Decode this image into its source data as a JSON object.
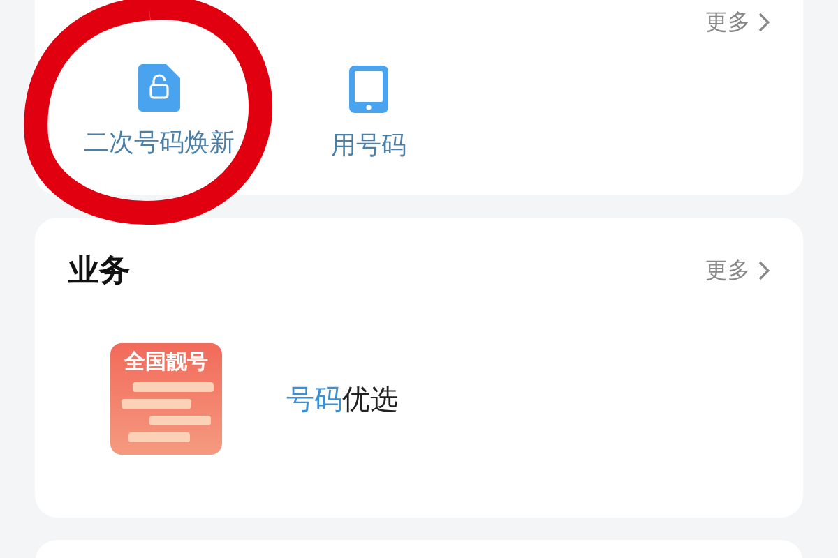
{
  "services": {
    "more": "更多",
    "items": [
      {
        "kind": "file",
        "label": "二次号码焕新"
      },
      {
        "kind": "phone",
        "label": "用号码"
      }
    ]
  },
  "business": {
    "title": "业务",
    "more": "更多",
    "items": [
      {
        "badge": "全国靓号",
        "highlight": "号码",
        "rest": "优选"
      }
    ]
  }
}
